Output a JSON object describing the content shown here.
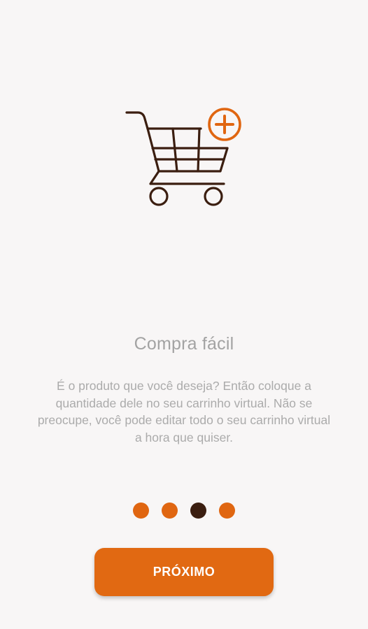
{
  "onboarding": {
    "illustration_icon": "cart-add-icon",
    "title": "Compra fácil",
    "description": "É o produto que você deseja? Então coloque a quantidade dele no seu carrinho virtual. Não se preocupe, você pode editar todo o seu carrinho virtual a hora que quiser.",
    "page_indicator": {
      "total": 4,
      "current": 3
    },
    "next_button_label": "PRÓXIMO"
  },
  "colors": {
    "background": "#f8f6f6",
    "accent": "#e16912",
    "icon_dark": "#3b1e10",
    "text_muted": "#a3a3a3"
  }
}
